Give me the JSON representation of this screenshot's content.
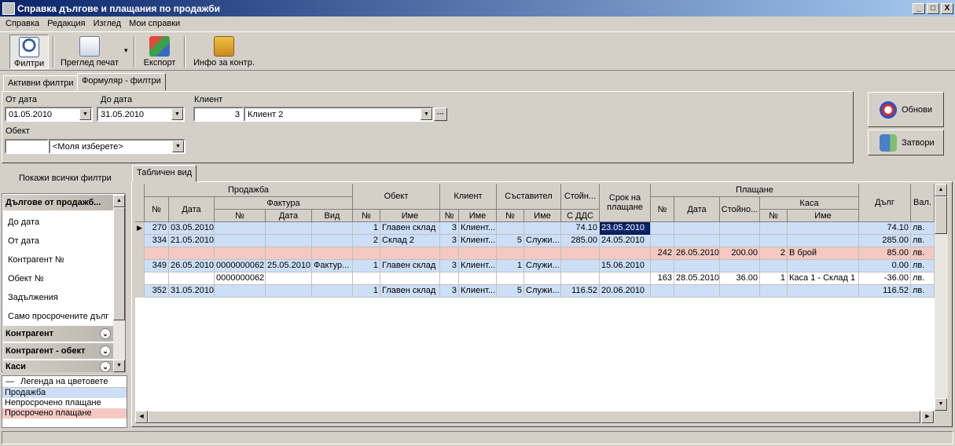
{
  "window": {
    "title": "Справка дългове и плащания по продажби",
    "min": "_",
    "max": "□",
    "close": "X"
  },
  "menu": [
    "Справка",
    "Редакция",
    "Изглед",
    "Мои справки"
  ],
  "toolbar": {
    "filters": "Филтри",
    "print_preview": "Преглед печат",
    "export": "Експорт",
    "info": "Инфо за контр.",
    "dropdown": "▾"
  },
  "tabs": {
    "active_filters": "Активни филтри",
    "form_filters": "Формуляр - филтри",
    "table_view": "Табличен вид"
  },
  "form": {
    "from_date_label": "От дата",
    "from_date": "01.05.2010",
    "to_date_label": "До дата",
    "to_date": "31.05.2010",
    "client_label": "Клиент",
    "client_id": "3",
    "client_name": "Клиент 2",
    "ellipsis": "···",
    "object_label": "Обект",
    "object_id": "",
    "object_placeholder": "<Моля изберете>"
  },
  "buttons": {
    "refresh": "Обнови",
    "close": "Затвори"
  },
  "left_panel": {
    "show_all": "Покажи всички филтри",
    "group1": "Дългове от продажб...",
    "items": [
      "До дата",
      "От дата",
      "Контрагент №",
      "Обект №",
      "Задължения",
      "Само просрочените дълг"
    ],
    "group2": "Контрагент",
    "group3": "Контрагент - обект",
    "group4": "Каси",
    "legend_title": "Легенда на цветовете",
    "legend_collapse": "—",
    "legend": [
      {
        "label": "Продажба",
        "color": "#cddff7"
      },
      {
        "label": "Непросрочено плащане",
        "color": "#ffffff"
      },
      {
        "label": "Просрочено плащане",
        "color": "#f4c9c4"
      }
    ]
  },
  "grid": {
    "groups": {
      "sale": "Продажба",
      "invoice": "Фактура",
      "object": "Обект",
      "client": "Клиент",
      "author": "Съставител",
      "value": "Стойн...",
      "due": "Срок на плащане",
      "payment": "Плащане",
      "cash": "Каса",
      "debt": "Дълг",
      "currency": "Вал."
    },
    "cols": {
      "no": "№",
      "date": "Дата",
      "inv_no": "№",
      "inv_date": "Дата",
      "inv_type": "Вид",
      "obj_no": "№",
      "obj_name": "Име",
      "cl_no": "№",
      "cl_name": "Име",
      "au_no": "№",
      "au_name": "Име",
      "vat": "С ДДС",
      "p_no": "№",
      "p_date": "Дата",
      "p_value": "Стойно...",
      "k_no": "№",
      "k_name": "Име"
    },
    "rows": [
      {
        "type": "sale",
        "cur": true,
        "no": "270",
        "date": "03.05.2010",
        "inv_no": "",
        "inv_date": "",
        "inv_type": "",
        "obj_no": "1",
        "obj_name": "Главен склад",
        "cl_no": "3",
        "cl_name": "Клиент...",
        "au_no": "",
        "au_name": "",
        "vat": "74.10",
        "due": "23.05.2010",
        "p_no": "",
        "p_date": "",
        "p_value": "",
        "k_no": "",
        "k_name": "",
        "debt": "74.10",
        "cur_lbl": "лв."
      },
      {
        "type": "sale",
        "no": "334",
        "date": "21.05.2010",
        "inv_no": "",
        "inv_date": "",
        "inv_type": "",
        "obj_no": "2",
        "obj_name": "Склад 2",
        "cl_no": "3",
        "cl_name": "Клиент...",
        "au_no": "5",
        "au_name": "Служи...",
        "vat": "285.00",
        "due": "24.05.2010",
        "p_no": "",
        "p_date": "",
        "p_value": "",
        "k_no": "",
        "k_name": "",
        "debt": "285.00",
        "cur_lbl": "лв."
      },
      {
        "type": "overdue",
        "no": "",
        "date": "",
        "inv_no": "",
        "inv_date": "",
        "inv_type": "",
        "obj_no": "",
        "obj_name": "",
        "cl_no": "",
        "cl_name": "",
        "au_no": "",
        "au_name": "",
        "vat": "",
        "due": "",
        "p_no": "242",
        "p_date": "26.05.2010",
        "p_value": "200.00",
        "k_no": "2",
        "k_name": "В брой",
        "debt": "85.00",
        "cur_lbl": "лв."
      },
      {
        "type": "sale",
        "no": "349",
        "date": "26.05.2010",
        "inv_no": "0000000062",
        "inv_date": "25.05.2010",
        "inv_type": "Фактур...",
        "obj_no": "1",
        "obj_name": "Главен склад",
        "cl_no": "3",
        "cl_name": "Клиент...",
        "au_no": "1",
        "au_name": "Служи...",
        "vat": "",
        "due": "15.06.2010",
        "p_no": "",
        "p_date": "",
        "p_value": "",
        "k_no": "",
        "k_name": "",
        "debt": "0.00",
        "cur_lbl": "лв."
      },
      {
        "type": "normal",
        "no": "",
        "date": "",
        "inv_no": "0000000062",
        "inv_date": "",
        "inv_type": "",
        "obj_no": "",
        "obj_name": "",
        "cl_no": "",
        "cl_name": "",
        "au_no": "",
        "au_name": "",
        "vat": "",
        "due": "",
        "p_no": "163",
        "p_date": "28.05.2010",
        "p_value": "36.00",
        "k_no": "1",
        "k_name": "Каса 1 - Склад 1",
        "debt": "-36.00",
        "cur_lbl": "лв."
      },
      {
        "type": "sale",
        "no": "352",
        "date": "31.05.2010",
        "inv_no": "",
        "inv_date": "",
        "inv_type": "",
        "obj_no": "1",
        "obj_name": "Главен склад",
        "cl_no": "3",
        "cl_name": "Клиент...",
        "au_no": "5",
        "au_name": "Служи...",
        "vat": "116.52",
        "due": "20.06.2010",
        "p_no": "",
        "p_date": "",
        "p_value": "",
        "k_no": "",
        "k_name": "",
        "debt": "116.52",
        "cur_lbl": "лв."
      }
    ]
  }
}
